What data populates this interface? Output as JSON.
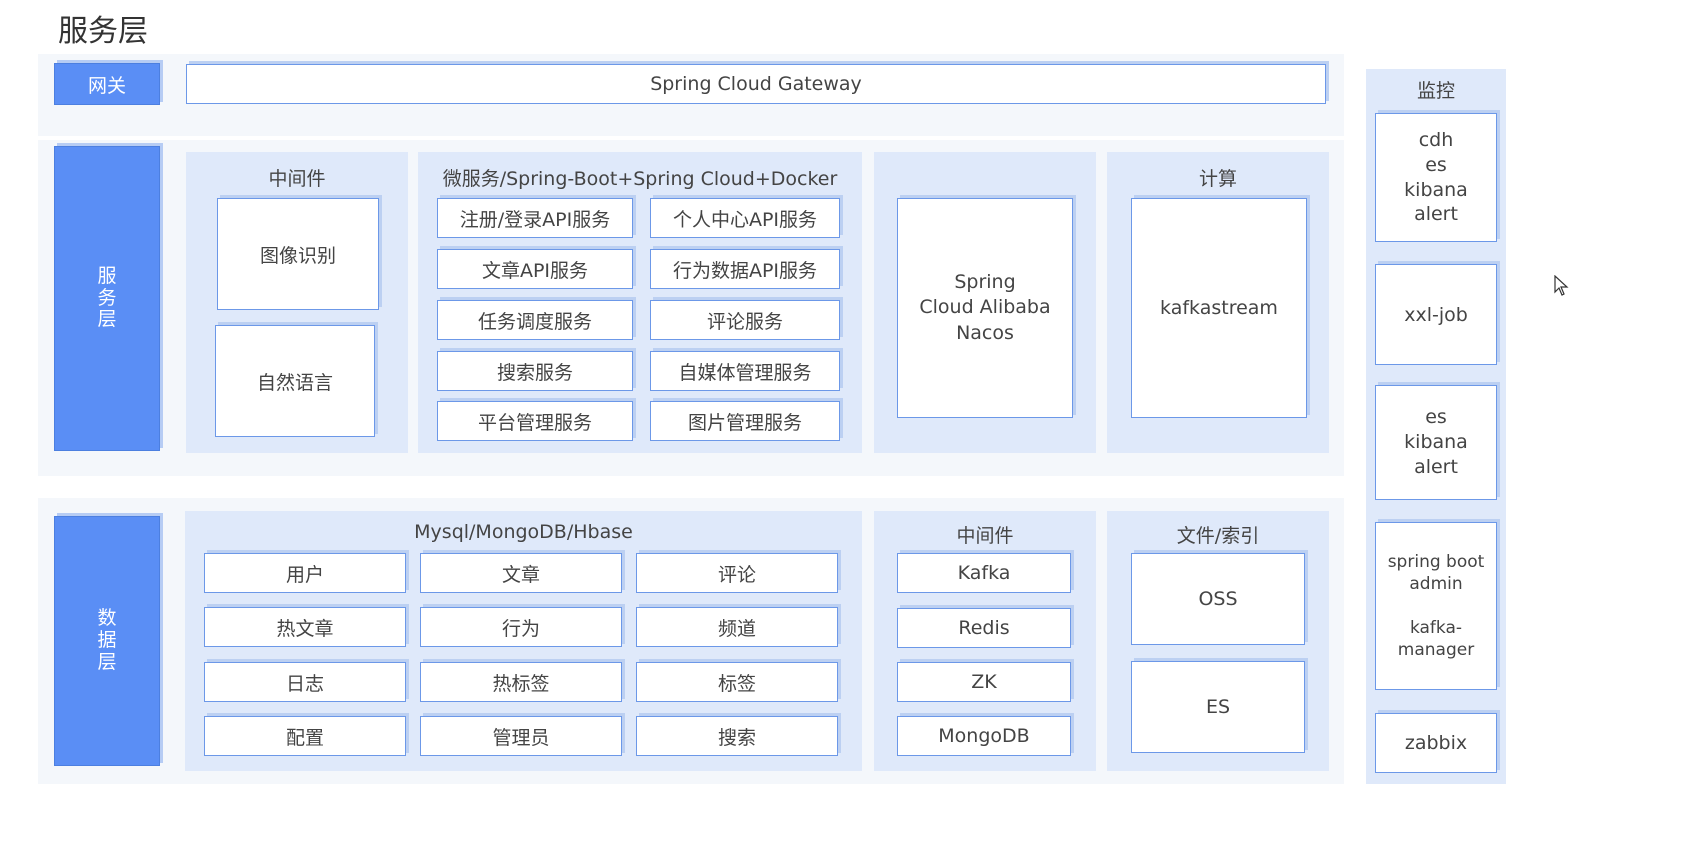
{
  "page_title": "服务层",
  "gateway": {
    "label": "网关",
    "name": "Spring Cloud Gateway"
  },
  "service_layer": {
    "label": [
      "服",
      "务",
      "层"
    ],
    "middleware": {
      "title": "中间件",
      "items": [
        "图像识别",
        "自然语言"
      ]
    },
    "microservices": {
      "title": "微服务/Spring-Boot+Spring Cloud+Docker",
      "left": [
        "注册/登录API服务",
        "文章API服务",
        "任务调度服务",
        "搜索服务",
        "平台管理服务"
      ],
      "right": [
        "个人中心API服务",
        "行为数据API服务",
        "评论服务",
        "自媒体管理服务",
        "图片管理服务"
      ]
    },
    "nacos": [
      "Spring",
      "Cloud Alibaba",
      "Nacos"
    ],
    "compute": {
      "title": "计算",
      "item": "kafkastream"
    }
  },
  "data_layer": {
    "label": [
      "数",
      "据",
      "层"
    ],
    "db": {
      "title": "Mysql/MongoDB/Hbase",
      "rows": [
        [
          "用户",
          "文章",
          "评论"
        ],
        [
          "热文章",
          "行为",
          "频道"
        ],
        [
          "日志",
          "热标签",
          "标签"
        ],
        [
          "配置",
          "管理员",
          "搜索"
        ]
      ]
    },
    "middleware": {
      "title": "中间件",
      "items": [
        "Kafka",
        "Redis",
        "ZK",
        "MongoDB"
      ]
    },
    "files": {
      "title": "文件/索引",
      "items": [
        "OSS",
        "ES"
      ]
    }
  },
  "monitoring": {
    "title": "监控",
    "group1": [
      "cdh",
      "es",
      "kibana",
      "alert"
    ],
    "group2": "xxl-job",
    "group3": [
      "es",
      "kibana",
      "alert"
    ],
    "group4": [
      "spring boot",
      "admin",
      "",
      "kafka-",
      "manager"
    ],
    "group5": "zabbix"
  },
  "colors": {
    "accent": "#5a8ef5",
    "panel": "#dfe9fa",
    "border": "#6c98e8"
  }
}
